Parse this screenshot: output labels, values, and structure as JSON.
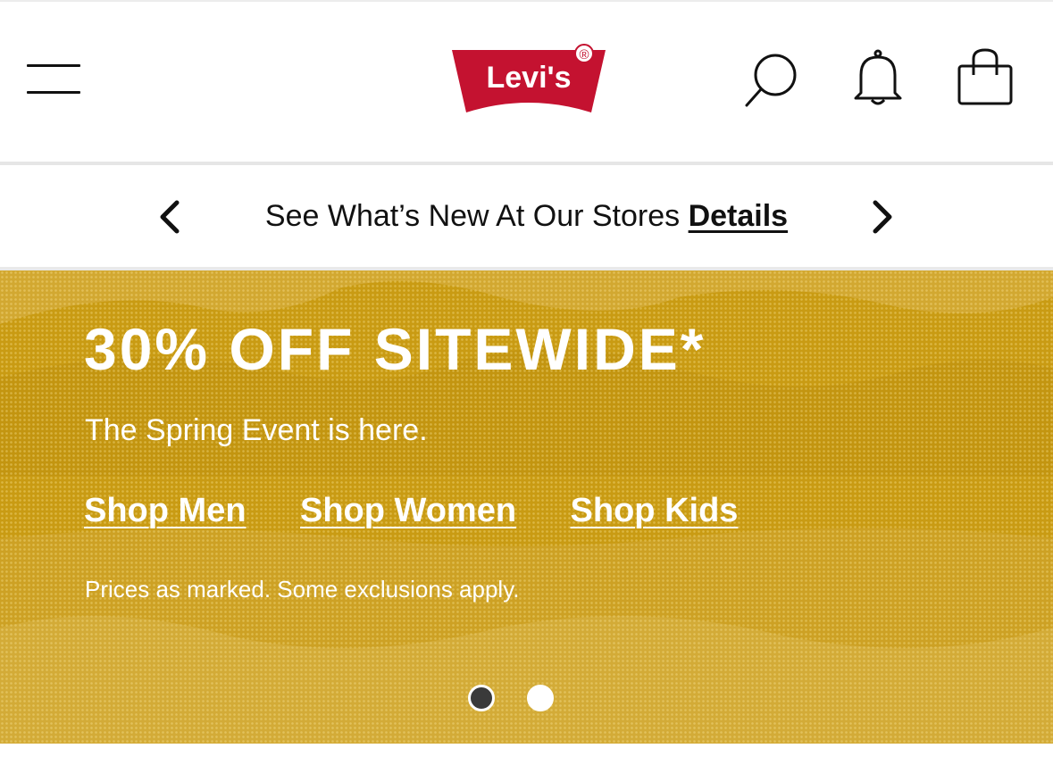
{
  "header": {
    "logo_text": "Levi's",
    "logo_mark": "®",
    "icons": [
      "menu-icon",
      "search-icon",
      "bell-icon",
      "shopping-bag-icon"
    ]
  },
  "promo_bar": {
    "message": "See What’s New At Our Stores",
    "link_label": "Details"
  },
  "hero": {
    "title": "30% OFF SITEWIDE*",
    "subtitle": "The Spring Event is here.",
    "links": [
      "Shop Men",
      "Shop Women",
      "Shop Kids"
    ],
    "disclaimer": "Prices as marked. Some exclusions apply.",
    "carousel": {
      "total_slides": 2,
      "active_slide": 1
    }
  },
  "colors": {
    "brand_red": "#c41230",
    "hero_background": "#c99b13",
    "text_dark": "#111111",
    "white": "#ffffff"
  }
}
